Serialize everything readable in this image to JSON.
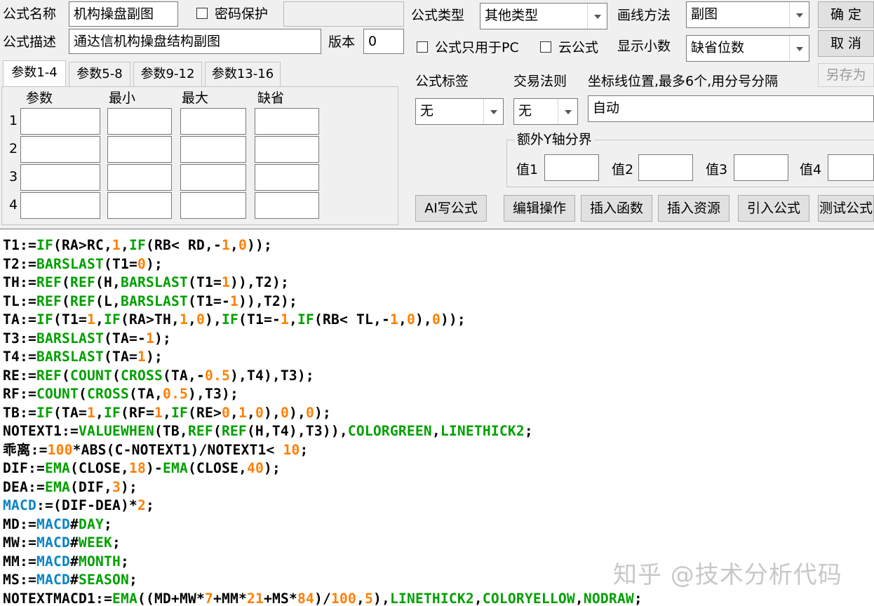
{
  "top": {
    "name_label": "公式名称",
    "name_value": "机构操盘副图",
    "pwd_label": "密码保护",
    "desc_label": "公式描述",
    "desc_value": "通达信机构操盘结构副图",
    "version_label": "版本",
    "version_value": "0",
    "type_label": "公式类型",
    "type_value": "其他类型",
    "draw_label": "画线方法",
    "draw_value": "副图",
    "pc_label": "公式只用于PC",
    "cloud_label": "云公式",
    "decimal_label": "显示小数",
    "decimal_value": "缺省位数",
    "ok_label": "确 定",
    "cancel_label": "取 消",
    "saveas_label": "另存为"
  },
  "tabs": [
    "参数1-4",
    "参数5-8",
    "参数9-12",
    "参数13-16"
  ],
  "params": {
    "headers": [
      "参数",
      "最小",
      "最大",
      "缺省"
    ],
    "rows": [
      "1",
      "2",
      "3",
      "4"
    ]
  },
  "right": {
    "tag_label": "公式标签",
    "tag_value": "无",
    "trade_label": "交易法则",
    "trade_value": "无",
    "axis_label": "坐标线位置,最多6个,用分号分隔",
    "axis_value": "自动",
    "yaxis_title": "额外Y轴分界",
    "v1": "值1",
    "v2": "值2",
    "v3": "值3",
    "v4": "值4"
  },
  "buttons": [
    "AI写公式",
    "编辑操作",
    "插入函数",
    "插入资源",
    "引入公式",
    "测试公式"
  ],
  "code_lines": [
    "T1:=IF(RA>RC,1,IF(RB< RD,-1,0));",
    "T2:=BARSLAST(T1=0);",
    "TH:=REF(REF(H,BARSLAST(T1=1)),T2);",
    "TL:=REF(REF(L,BARSLAST(T1=-1)),T2);",
    "TA:=IF(T1=1,IF(RA>TH,1,0),IF(T1=-1,IF(RB< TL,-1,0),0));",
    "T3:=BARSLAST(TA=-1);",
    "T4:=BARSLAST(TA=1);",
    "RE:=REF(COUNT(CROSS(TA,-0.5),T4),T3);",
    "RF:=COUNT(CROSS(TA,0.5),T3);",
    "TB:=IF(TA=1,IF(RF=1,IF(RE>0,1,0),0),0);",
    "NOTEXT1:=VALUEWHEN(TB,REF(REF(H,T4),T3)),COLORGREEN,LINETHICK2;",
    "乖离:=100*ABS(C-NOTEXT1)/NOTEXT1< 10;",
    "DIF:=EMA(CLOSE,18)-EMA(CLOSE,40);",
    "DEA:=EMA(DIF,3);",
    "MACD:=(DIF-DEA)*2;",
    "MD:=MACD#DAY;",
    "MW:=MACD#WEEK;",
    "MM:=MACD#MONTH;",
    "MS:=MACD#SEASON;",
    "NOTEXTMACD1:=EMA((MD+MW*7+MM*21+MS*84)/100,5),LINETHICK2,COLORYELLOW,NODRAW;"
  ],
  "watermark": "知乎 @技术分析代码",
  "colors": {
    "function": "#00a000",
    "number": "#ff7f00",
    "variable": "#0a84c6"
  }
}
